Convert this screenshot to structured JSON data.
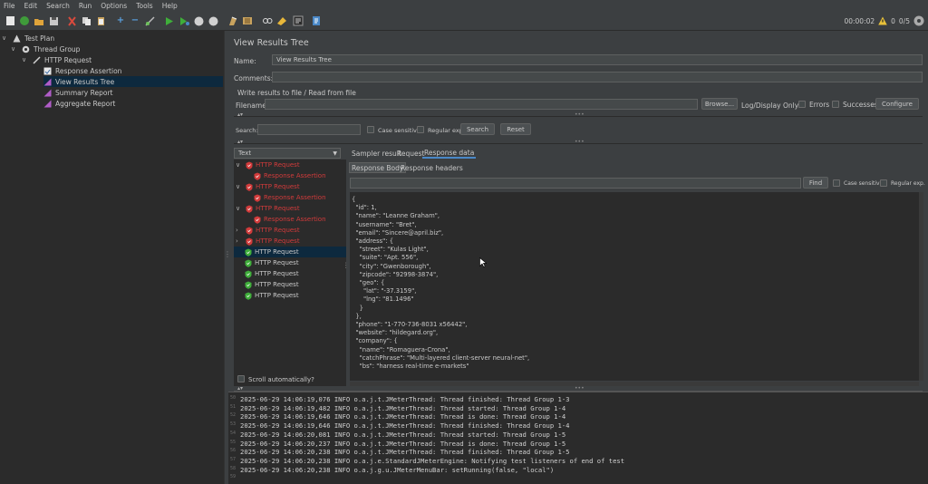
{
  "menu": [
    "File",
    "Edit",
    "Search",
    "Run",
    "Options",
    "Tools",
    "Help"
  ],
  "toolbar_status": {
    "elapsed": "00:00:02",
    "warnings": "0",
    "threads": "0/5"
  },
  "tree": {
    "items": [
      {
        "label": "Test Plan",
        "icon": "test-plan-icon"
      },
      {
        "label": "Thread Group",
        "icon": "gear-icon"
      },
      {
        "label": "HTTP Request",
        "icon": "pipette-icon"
      },
      {
        "label": "Response Assertion",
        "icon": "assertion-icon"
      },
      {
        "label": "View Results Tree",
        "icon": "chart-icon"
      },
      {
        "label": "Summary Report",
        "icon": "chart-icon"
      },
      {
        "label": "Aggregate Report",
        "icon": "chart-icon"
      }
    ]
  },
  "panel": {
    "title": "View Results Tree",
    "name_label": "Name:",
    "name_value": "View Results Tree",
    "comments_label": "Comments:",
    "write_results": "Write results to file / Read from file",
    "filename_label": "Filename",
    "browse": "Browse...",
    "log_display_only": "Log/Display Only:",
    "errors": "Errors",
    "successes": "Successes",
    "configure": "Configure",
    "search_label": "Search:",
    "case_sensitive": "Case sensitive",
    "regular_exp": "Regular exp.",
    "search_btn": "Search",
    "reset_btn": "Reset",
    "renderer": "Text",
    "scroll_auto": "Scroll automatically?"
  },
  "results": [
    {
      "label": "HTTP Request",
      "status": "error"
    },
    {
      "label": "Response Assertion",
      "status": "error"
    },
    {
      "label": "HTTP Request",
      "status": "error"
    },
    {
      "label": "Response Assertion",
      "status": "error"
    },
    {
      "label": "HTTP Request",
      "status": "error"
    },
    {
      "label": "Response Assertion",
      "status": "error"
    },
    {
      "label": "HTTP Request",
      "status": "error"
    },
    {
      "label": "HTTP Request",
      "status": "error"
    },
    {
      "label": "HTTP Request",
      "status": "ok"
    },
    {
      "label": "HTTP Request",
      "status": "ok"
    },
    {
      "label": "HTTP Request",
      "status": "ok"
    },
    {
      "label": "HTTP Request",
      "status": "ok"
    },
    {
      "label": "HTTP Request",
      "status": "ok"
    }
  ],
  "tabs": [
    "Sampler result",
    "Request",
    "Response data"
  ],
  "subtabs": [
    "Response Body",
    "Response headers"
  ],
  "find": {
    "button": "Find",
    "case_sensitive": "Case sensitive",
    "regular_exp": "Regular exp."
  },
  "json_lines": [
    "{",
    "  \"id\": 1,",
    "  \"name\": \"Leanne Graham\",",
    "  \"username\": \"Bret\",",
    "  \"email\": \"Sincere@april.biz\",",
    "  \"address\": {",
    "    \"street\": \"Kulas Light\",",
    "    \"suite\": \"Apt. 556\",",
    "    \"city\": \"Gwenborough\",",
    "    \"zipcode\": \"92998-3874\",",
    "    \"geo\": {",
    "      \"lat\": \"-37.3159\",",
    "      \"lng\": \"81.1496\"",
    "    }",
    "  },",
    "  \"phone\": \"1-770-736-8031 x56442\",",
    "  \"website\": \"hildegard.org\",",
    "  \"company\": {",
    "    \"name\": \"Romaguera-Crona\",",
    "    \"catchPhrase\": \"Multi-layered client-server neural-net\",",
    "    \"bs\": \"harness real-time e-markets\""
  ],
  "log": [
    {
      "n": "50",
      "text": "2025-06-29 14:06:19,076 INFO o.a.j.t.JMeterThread: Thread finished: Thread Group 1-3"
    },
    {
      "n": "51",
      "text": "2025-06-29 14:06:19,482 INFO o.a.j.t.JMeterThread: Thread started: Thread Group 1-4"
    },
    {
      "n": "52",
      "text": "2025-06-29 14:06:19,646 INFO o.a.j.t.JMeterThread: Thread is done: Thread Group 1-4"
    },
    {
      "n": "53",
      "text": "2025-06-29 14:06:19,646 INFO o.a.j.t.JMeterThread: Thread finished: Thread Group 1-4"
    },
    {
      "n": "54",
      "text": "2025-06-29 14:06:20,081 INFO o.a.j.t.JMeterThread: Thread started: Thread Group 1-5"
    },
    {
      "n": "55",
      "text": "2025-06-29 14:06:20,237 INFO o.a.j.t.JMeterThread: Thread is done: Thread Group 1-5"
    },
    {
      "n": "56",
      "text": "2025-06-29 14:06:20,238 INFO o.a.j.t.JMeterThread: Thread finished: Thread Group 1-5"
    },
    {
      "n": "57",
      "text": "2025-06-29 14:06:20,238 INFO o.a.j.e.StandardJMeterEngine: Notifying test listeners of end of test"
    },
    {
      "n": "58",
      "text": "2025-06-29 14:06:20,238 INFO o.a.j.g.u.JMeterMenuBar: setRunning(false, \"local\")"
    },
    {
      "n": "59",
      "text": ""
    }
  ]
}
